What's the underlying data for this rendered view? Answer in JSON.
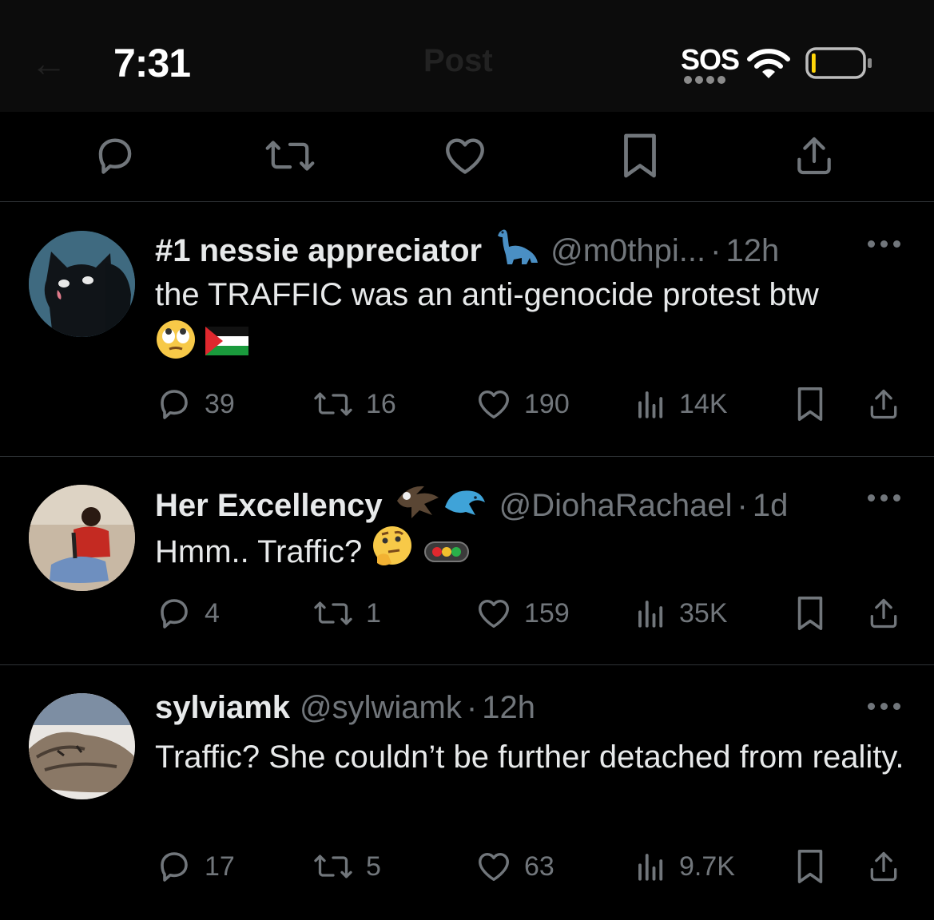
{
  "status_bar": {
    "time": "7:31",
    "sos": "SOS",
    "header_back_ghost": "←",
    "header_title_ghost": "Post",
    "battery_level": 0.08
  },
  "action_bar": {
    "icons": [
      "reply-icon",
      "repost-icon",
      "like-icon",
      "bookmark-icon",
      "share-icon"
    ]
  },
  "replies": [
    {
      "name": "#1 nessie appreciator",
      "badge": "🦕",
      "handle": "@m0thpi...",
      "separator": "·",
      "time": "12h",
      "text": "the TRAFFIC was an anti-genocide protest btw",
      "text_emojis": "🙄🇵🇸",
      "metrics": {
        "replies": "39",
        "reposts": "16",
        "likes": "190",
        "views": "14K"
      }
    },
    {
      "name": "Her Excellency",
      "badge": "🦅🐬",
      "handle": "@DiohaRachael",
      "separator": "·",
      "time": "1d",
      "text": "Hmm.. Traffic?",
      "text_emojis": "🤔🚥",
      "metrics": {
        "replies": "4",
        "reposts": "1",
        "likes": "159",
        "views": "35K"
      }
    },
    {
      "name": "sylviamk",
      "badge": "",
      "handle": "@sylwiamk",
      "separator": "·",
      "time": "12h",
      "text": "Traffic? She couldn’t be further detached from reality.",
      "text_emojis": "",
      "metrics": {
        "replies": "17",
        "reposts": "5",
        "likes": "63",
        "views": "9.7K"
      }
    }
  ],
  "colors": {
    "background": "#000000",
    "text_primary": "#e7e9ea",
    "text_secondary": "#71767b",
    "divider": "#2f3336"
  }
}
